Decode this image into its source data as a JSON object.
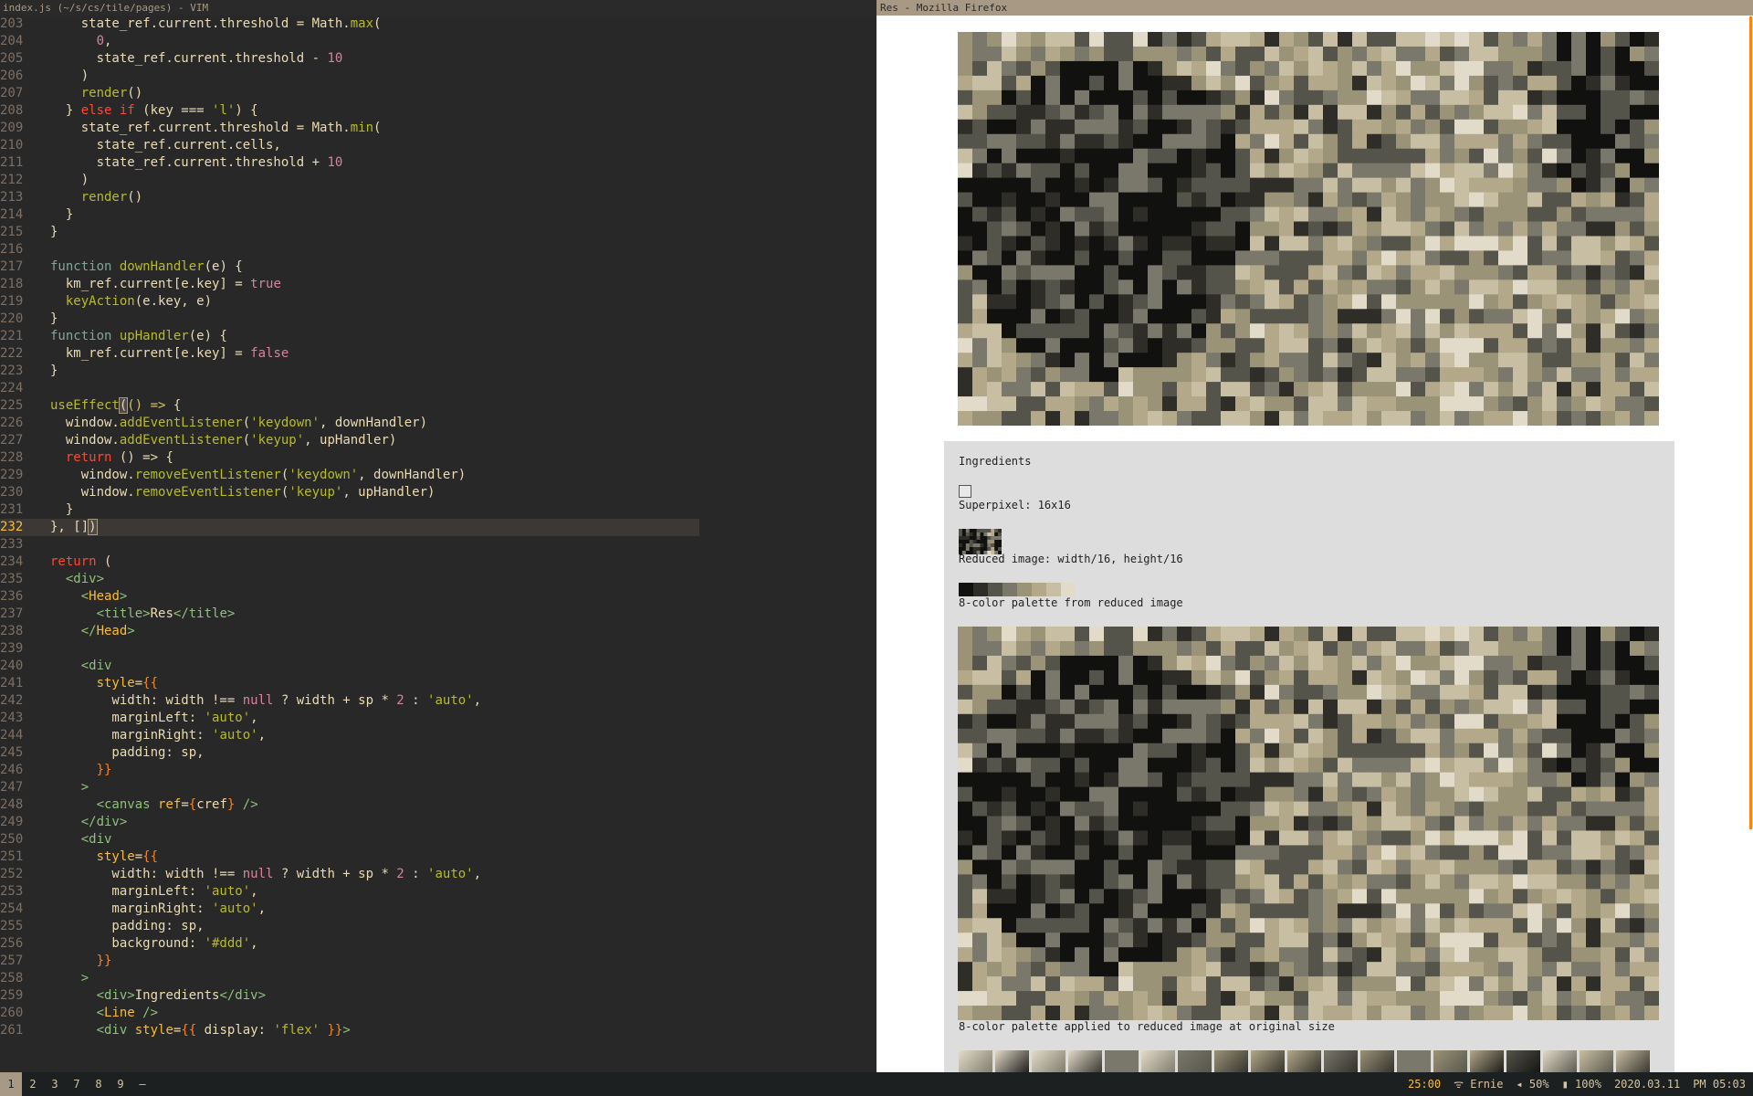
{
  "vim": {
    "title": "index.js (~/s/cs/tile/pages) - VIM",
    "cursor_line": 232,
    "lines": [
      {
        "n": "203",
        "t": [
          [
            "p",
            "    state_ref.current.threshold = Math."
          ],
          [
            "f",
            "max"
          ],
          [
            "p",
            "("
          ]
        ]
      },
      {
        "n": "204",
        "t": [
          [
            "p",
            "      "
          ],
          [
            "n",
            "0"
          ],
          [
            "p",
            ","
          ]
        ]
      },
      {
        "n": "205",
        "t": [
          [
            "p",
            "      state_ref.current.threshold - "
          ],
          [
            "n",
            "10"
          ]
        ]
      },
      {
        "n": "206",
        "t": [
          [
            "p",
            "    )"
          ]
        ]
      },
      {
        "n": "207",
        "t": [
          [
            "p",
            "    "
          ],
          [
            "f",
            "render"
          ],
          [
            "p",
            "()"
          ]
        ]
      },
      {
        "n": "208",
        "t": [
          [
            "p",
            "  } "
          ],
          [
            "k",
            "else if"
          ],
          [
            "p",
            " (key === "
          ],
          [
            "s",
            "'l'"
          ],
          [
            "p",
            ") {"
          ]
        ]
      },
      {
        "n": "209",
        "t": [
          [
            "p",
            "    state_ref.current.threshold = Math."
          ],
          [
            "f",
            "min"
          ],
          [
            "p",
            "("
          ]
        ]
      },
      {
        "n": "210",
        "t": [
          [
            "p",
            "      state_ref.current.cells,"
          ]
        ]
      },
      {
        "n": "211",
        "t": [
          [
            "p",
            "      state_ref.current.threshold + "
          ],
          [
            "n",
            "10"
          ]
        ]
      },
      {
        "n": "212",
        "t": [
          [
            "p",
            "    )"
          ]
        ]
      },
      {
        "n": "213",
        "t": [
          [
            "p",
            "    "
          ],
          [
            "f",
            "render"
          ],
          [
            "p",
            "()"
          ]
        ]
      },
      {
        "n": "214",
        "t": [
          [
            "p",
            "  }"
          ]
        ]
      },
      {
        "n": "215",
        "t": [
          [
            "p",
            "}"
          ]
        ]
      },
      {
        "n": "216",
        "t": []
      },
      {
        "n": "217",
        "t": [
          [
            "d",
            "function"
          ],
          [
            "p",
            " "
          ],
          [
            "f",
            "downHandler"
          ],
          [
            "p",
            "(e) {"
          ]
        ]
      },
      {
        "n": "218",
        "t": [
          [
            "p",
            "  km_ref.current[e.key] = "
          ],
          [
            "b",
            "true"
          ]
        ]
      },
      {
        "n": "219",
        "t": [
          [
            "p",
            "  "
          ],
          [
            "f",
            "keyAction"
          ],
          [
            "p",
            "(e.key, e)"
          ]
        ]
      },
      {
        "n": "220",
        "t": [
          [
            "p",
            "}"
          ]
        ]
      },
      {
        "n": "221",
        "t": [
          [
            "d",
            "function"
          ],
          [
            "p",
            " "
          ],
          [
            "f",
            "upHandler"
          ],
          [
            "p",
            "(e) {"
          ]
        ]
      },
      {
        "n": "222",
        "t": [
          [
            "p",
            "  km_ref.current[e.key] = "
          ],
          [
            "b",
            "false"
          ]
        ]
      },
      {
        "n": "223",
        "t": [
          [
            "p",
            "}"
          ]
        ]
      },
      {
        "n": "224",
        "t": []
      },
      {
        "n": "225",
        "t": [
          [
            "f",
            "useEffect"
          ],
          [
            "c",
            "("
          ],
          [
            "u",
            "() =>"
          ],
          [
            "p",
            " {"
          ]
        ]
      },
      {
        "n": "226",
        "t": [
          [
            "p",
            "  window."
          ],
          [
            "f",
            "addEventListener"
          ],
          [
            "p",
            "("
          ],
          [
            "s",
            "'keydown'"
          ],
          [
            "p",
            ", downHandler)"
          ]
        ]
      },
      {
        "n": "227",
        "t": [
          [
            "p",
            "  window."
          ],
          [
            "f",
            "addEventListener"
          ],
          [
            "p",
            "("
          ],
          [
            "s",
            "'keyup'"
          ],
          [
            "p",
            ", upHandler)"
          ]
        ]
      },
      {
        "n": "228",
        "t": [
          [
            "p",
            "  "
          ],
          [
            "k",
            "return"
          ],
          [
            "p",
            " () => {"
          ]
        ]
      },
      {
        "n": "229",
        "t": [
          [
            "p",
            "    window."
          ],
          [
            "f",
            "removeEventListener"
          ],
          [
            "p",
            "("
          ],
          [
            "s",
            "'keydown'"
          ],
          [
            "p",
            ", downHandler)"
          ]
        ]
      },
      {
        "n": "230",
        "t": [
          [
            "p",
            "    window."
          ],
          [
            "f",
            "removeEventListener"
          ],
          [
            "p",
            "("
          ],
          [
            "s",
            "'keyup'"
          ],
          [
            "p",
            ", upHandler)"
          ]
        ]
      },
      {
        "n": "231",
        "t": [
          [
            "p",
            "  }"
          ]
        ]
      },
      {
        "n": "232",
        "t": [
          [
            "p",
            "}, []"
          ],
          [
            "c",
            ")"
          ]
        ]
      },
      {
        "n": "233",
        "t": []
      },
      {
        "n": "234",
        "t": [
          [
            "k",
            "return"
          ],
          [
            "p",
            " ("
          ]
        ]
      },
      {
        "n": "235",
        "t": [
          [
            "p",
            "  "
          ],
          [
            "g",
            "<div>"
          ]
        ]
      },
      {
        "n": "236",
        "t": [
          [
            "p",
            "    "
          ],
          [
            "g",
            "<"
          ],
          [
            "y",
            "Head"
          ],
          [
            "g",
            ">"
          ]
        ]
      },
      {
        "n": "237",
        "t": [
          [
            "p",
            "      "
          ],
          [
            "g",
            "<title>"
          ],
          [
            "p",
            "Res"
          ],
          [
            "g",
            "</title>"
          ]
        ]
      },
      {
        "n": "238",
        "t": [
          [
            "p",
            "    "
          ],
          [
            "g",
            "</"
          ],
          [
            "y",
            "Head"
          ],
          [
            "g",
            ">"
          ]
        ]
      },
      {
        "n": "239",
        "t": []
      },
      {
        "n": "240",
        "t": [
          [
            "p",
            "    "
          ],
          [
            "g",
            "<div"
          ]
        ]
      },
      {
        "n": "241",
        "t": [
          [
            "p",
            "      "
          ],
          [
            "a",
            "style"
          ],
          [
            "p",
            "="
          ],
          [
            "o",
            "{{"
          ]
        ]
      },
      {
        "n": "242",
        "t": [
          [
            "p",
            "        width: width !== "
          ],
          [
            "b",
            "null"
          ],
          [
            "p",
            " ? width + sp * "
          ],
          [
            "n",
            "2"
          ],
          [
            "p",
            " : "
          ],
          [
            "s",
            "'auto'"
          ],
          [
            "p",
            ","
          ]
        ]
      },
      {
        "n": "243",
        "t": [
          [
            "p",
            "        marginLeft: "
          ],
          [
            "s",
            "'auto'"
          ],
          [
            "p",
            ","
          ]
        ]
      },
      {
        "n": "244",
        "t": [
          [
            "p",
            "        marginRight: "
          ],
          [
            "s",
            "'auto'"
          ],
          [
            "p",
            ","
          ]
        ]
      },
      {
        "n": "245",
        "t": [
          [
            "p",
            "        padding: sp,"
          ]
        ]
      },
      {
        "n": "246",
        "t": [
          [
            "p",
            "      "
          ],
          [
            "o",
            "}}"
          ]
        ]
      },
      {
        "n": "247",
        "t": [
          [
            "p",
            "    "
          ],
          [
            "g",
            ">"
          ]
        ]
      },
      {
        "n": "248",
        "t": [
          [
            "p",
            "      "
          ],
          [
            "g",
            "<canvas "
          ],
          [
            "a",
            "ref"
          ],
          [
            "p",
            "="
          ],
          [
            "o",
            "{"
          ],
          [
            "p",
            "cref"
          ],
          [
            "o",
            "}"
          ],
          [
            "g",
            " />"
          ]
        ]
      },
      {
        "n": "249",
        "t": [
          [
            "p",
            "    "
          ],
          [
            "g",
            "</div>"
          ]
        ]
      },
      {
        "n": "250",
        "t": [
          [
            "p",
            "    "
          ],
          [
            "g",
            "<div"
          ]
        ]
      },
      {
        "n": "251",
        "t": [
          [
            "p",
            "      "
          ],
          [
            "a",
            "style"
          ],
          [
            "p",
            "="
          ],
          [
            "o",
            "{{"
          ]
        ]
      },
      {
        "n": "252",
        "t": [
          [
            "p",
            "        width: width !== "
          ],
          [
            "b",
            "null"
          ],
          [
            "p",
            " ? width + sp * "
          ],
          [
            "n",
            "2"
          ],
          [
            "p",
            " : "
          ],
          [
            "s",
            "'auto'"
          ],
          [
            "p",
            ","
          ]
        ]
      },
      {
        "n": "253",
        "t": [
          [
            "p",
            "        marginLeft: "
          ],
          [
            "s",
            "'auto'"
          ],
          [
            "p",
            ","
          ]
        ]
      },
      {
        "n": "254",
        "t": [
          [
            "p",
            "        marginRight: "
          ],
          [
            "s",
            "'auto'"
          ],
          [
            "p",
            ","
          ]
        ]
      },
      {
        "n": "255",
        "t": [
          [
            "p",
            "        padding: sp,"
          ]
        ]
      },
      {
        "n": "256",
        "t": [
          [
            "p",
            "        background: "
          ],
          [
            "s",
            "'#ddd'"
          ],
          [
            "p",
            ","
          ]
        ]
      },
      {
        "n": "257",
        "t": [
          [
            "p",
            "      "
          ],
          [
            "o",
            "}}"
          ]
        ]
      },
      {
        "n": "258",
        "t": [
          [
            "p",
            "    "
          ],
          [
            "g",
            ">"
          ]
        ]
      },
      {
        "n": "259",
        "t": [
          [
            "p",
            "      "
          ],
          [
            "g",
            "<div>"
          ],
          [
            "p",
            "Ingredients"
          ],
          [
            "g",
            "</div>"
          ]
        ]
      },
      {
        "n": "260",
        "t": [
          [
            "p",
            "      "
          ],
          [
            "g",
            "<"
          ],
          [
            "y",
            "Line"
          ],
          [
            "g",
            " />"
          ]
        ]
      },
      {
        "n": "261",
        "t": [
          [
            "p",
            "      "
          ],
          [
            "g",
            "<div "
          ],
          [
            "a",
            "style"
          ],
          [
            "p",
            "="
          ],
          [
            "o",
            "{{"
          ],
          [
            "p",
            " display: "
          ],
          [
            "s",
            "'flex'"
          ],
          [
            "p",
            " "
          ],
          [
            "o",
            "}}"
          ],
          [
            "g",
            ">"
          ]
        ]
      }
    ]
  },
  "firefox": {
    "title": "Res - Mozilla Firefox",
    "ingredients_heading": "Ingredients",
    "superpixel_label": "Superpixel: 16x16",
    "reduced_label": "Reduced image: width/16, height/16",
    "palette_label": "8-color palette from reduced image",
    "applied_label": "8-color palette applied to reduced image at original size",
    "palette_colors": [
      "#111110",
      "#2e2d28",
      "#55544a",
      "#7a786a",
      "#9a9377",
      "#b3a88a",
      "#c8bea3",
      "#e2dbc9"
    ],
    "accent_color": "#fe8019"
  },
  "statusbar": {
    "workspaces": [
      "1",
      "2",
      "3",
      "7",
      "8",
      "9",
      "—"
    ],
    "active_workspace": "1",
    "timer": "25:00",
    "wifi_icon": "wifi-icon",
    "wifi": "Ernie",
    "volume_icon": "volume-icon",
    "volume": "50%",
    "battery_icon": "battery-icon",
    "battery": "100%",
    "date": "2020.03.11",
    "time": "PM 05:03"
  }
}
